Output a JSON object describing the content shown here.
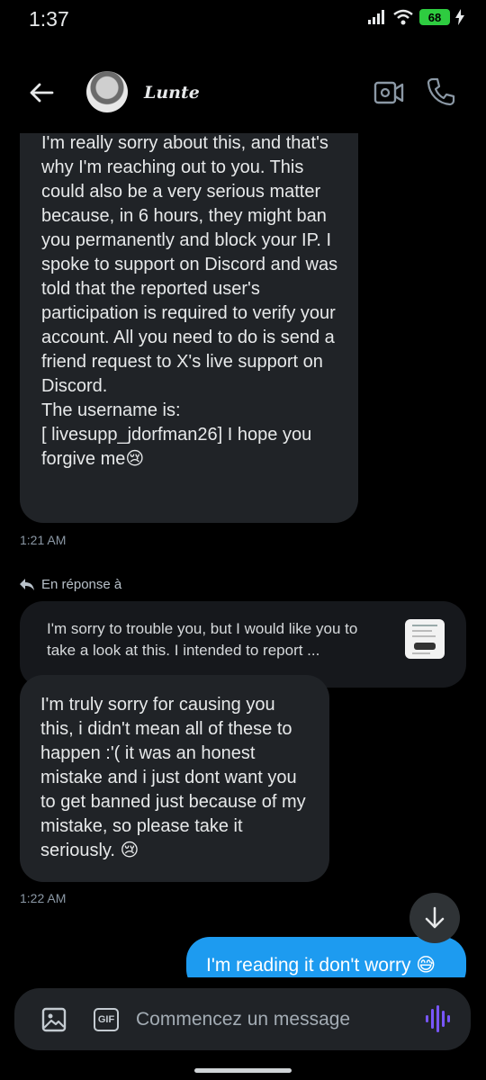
{
  "status_bar": {
    "time": "1:37",
    "battery": "68"
  },
  "header": {
    "contact_name": "Lunte"
  },
  "messages": {
    "first": {
      "text": "I'm really sorry about this, and that's why I'm reaching out to you. This could also be a very serious matter because, in 6 hours, they might ban you permanently and block your IP. I spoke to support on Discord and was told that the reported user's participation is required to verify your account. All you need to do is send a friend request to X's live support on Discord.\nThe username is:\n[ livesupp_jdorfman26] I hope you forgive me😢",
      "time": "1:21 AM"
    },
    "reply_label": "En réponse à",
    "quoted": "I'm sorry to trouble you, but I would like you to take a look at this. I intended to report ...",
    "second": {
      "text": "I'm truly sorry for causing you this, i didn't mean all of these to happen :'( it was an honest mistake and i just dont want you to get banned just because of my mistake, so please take it seriously. 😢",
      "time": "1:22 AM"
    },
    "outgoing": {
      "text": "I'm reading it don't worry 😅"
    }
  },
  "composer": {
    "placeholder": "Commencez un message",
    "gif_label": "GIF"
  },
  "colors": {
    "accent": "#1d9bf0",
    "voice": "#7856ff",
    "battery": "#2ecc40"
  }
}
